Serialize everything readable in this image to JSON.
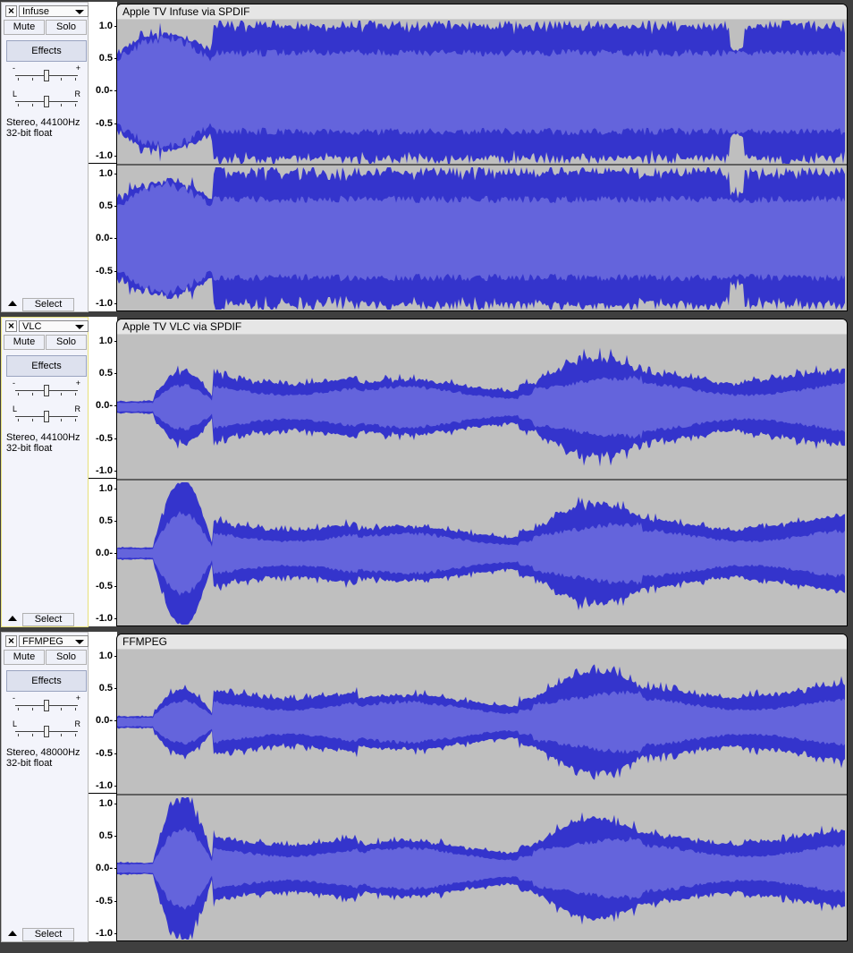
{
  "colors": {
    "wave_dark": "#3434cc",
    "wave_rms": "#6464dc",
    "wave_bg": "#bfbfbf",
    "panel_bg": "#f3f4fb",
    "selected_border": "#e6e07a"
  },
  "tracks": [
    {
      "name": "Infuse",
      "clip_title": "Apple TV Infuse via SPDIF",
      "mute_label": "Mute",
      "solo_label": "Solo",
      "effects_label": "Effects",
      "gain_minus": "-",
      "gain_plus": "+",
      "pan_left": "L",
      "pan_right": "R",
      "info_line1": "Stereo, 44100Hz",
      "info_line2": "32-bit float",
      "select_label": "Select",
      "selected": false,
      "profile": "infuse",
      "ruler_labels": [
        "1.0",
        "0.5",
        "0.0-",
        "-0.5",
        "-1.0"
      ]
    },
    {
      "name": "VLC",
      "clip_title": "Apple TV VLC via SPDIF",
      "mute_label": "Mute",
      "solo_label": "Solo",
      "effects_label": "Effects",
      "gain_minus": "-",
      "gain_plus": "+",
      "pan_left": "L",
      "pan_right": "R",
      "info_line1": "Stereo, 44100Hz",
      "info_line2": "32-bit float",
      "select_label": "Select",
      "selected": true,
      "profile": "vlc",
      "ruler_labels": [
        "1.0",
        "0.5",
        "0.0-",
        "-0.5",
        "-1.0"
      ]
    },
    {
      "name": "FFMPEG",
      "clip_title": "FFMPEG",
      "mute_label": "Mute",
      "solo_label": "Solo",
      "effects_label": "Effects",
      "gain_minus": "-",
      "gain_plus": "+",
      "pan_left": "L",
      "pan_right": "R",
      "info_line1": "Stereo, 48000Hz",
      "info_line2": "32-bit float",
      "select_label": "Select",
      "selected": false,
      "profile": "ffmpeg",
      "ruler_labels": [
        "1.0",
        "0.5",
        "0.0-",
        "-0.5",
        "-1.0"
      ]
    }
  ]
}
